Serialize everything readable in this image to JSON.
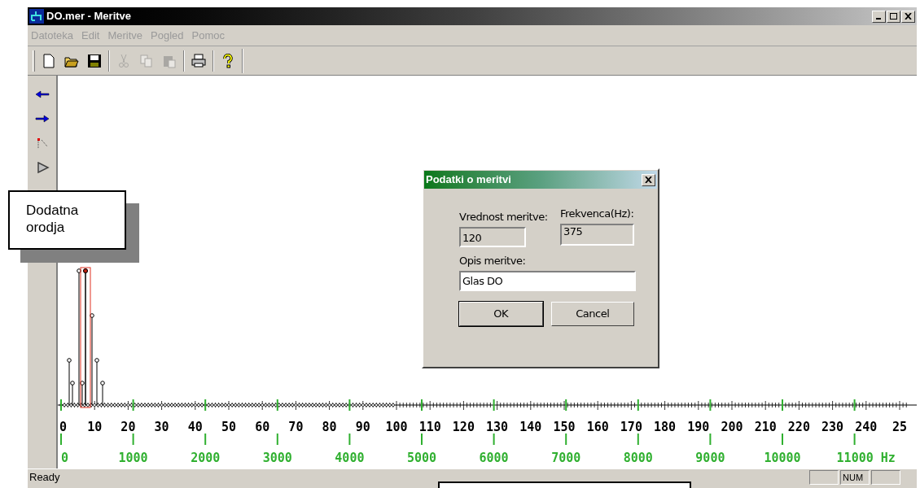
{
  "window": {
    "title": "DO.mer - Meritve"
  },
  "menu": [
    "Datoteka",
    "Edit",
    "Meritve",
    "Pogled",
    "Pomoc"
  ],
  "toolbar": [
    {
      "kind": "new",
      "disabled": false
    },
    {
      "kind": "open",
      "disabled": false
    },
    {
      "kind": "save",
      "disabled": false
    },
    {
      "kind": "sep"
    },
    {
      "kind": "cut",
      "disabled": true
    },
    {
      "kind": "copy",
      "disabled": true
    },
    {
      "kind": "paste",
      "disabled": true
    },
    {
      "kind": "sep"
    },
    {
      "kind": "print",
      "disabled": false
    },
    {
      "kind": "sep"
    },
    {
      "kind": "help",
      "disabled": false
    }
  ],
  "side_tools": [
    {
      "kind": "arrow-left"
    },
    {
      "kind": "arrow-right"
    },
    {
      "kind": "marker"
    },
    {
      "kind": "play"
    }
  ],
  "chart": {
    "x_labels": [
      "0",
      "10",
      "20",
      "30",
      "40",
      "50",
      "60",
      "70",
      "80",
      "90",
      "100",
      "110",
      "120",
      "130",
      "140",
      "150",
      "160",
      "170",
      "180",
      "190",
      "200",
      "210",
      "220",
      "230",
      "240",
      "25"
    ],
    "hz_labels": [
      "0",
      "1000",
      "2000",
      "3000",
      "4000",
      "5000",
      "6000",
      "7000",
      "8000",
      "9000",
      "10000",
      "11000 Hz"
    ]
  },
  "dialog": {
    "title": "Podatki o meritvi",
    "value_label": "Vrednost meritve:",
    "value": "120",
    "freq_label": "Frekvenca(Hz):",
    "freq": "375",
    "desc_label": "Opis meritve:",
    "desc": "Glas DO",
    "buttons": [
      "OK",
      "Cancel"
    ]
  },
  "callout": {
    "text": "Dodatna orodja"
  },
  "status_bar": {
    "text": "Ready",
    "panes": [
      "NUM"
    ]
  }
}
